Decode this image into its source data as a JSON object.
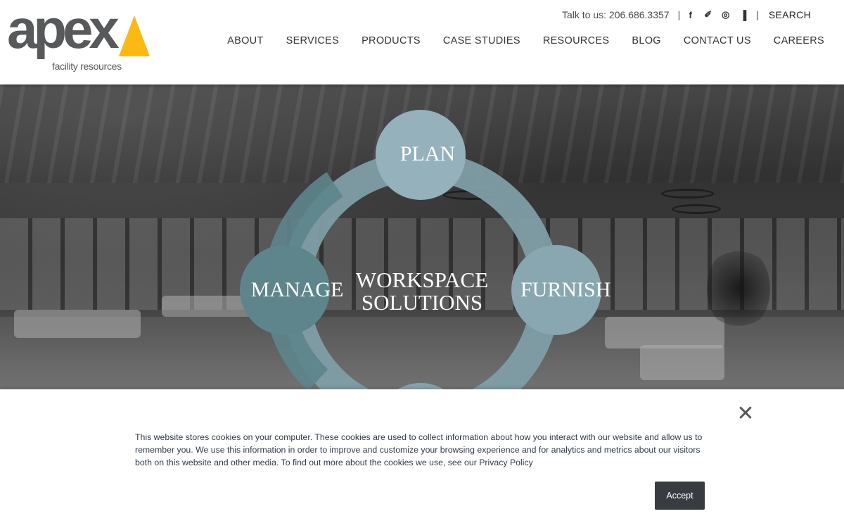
{
  "header": {
    "logo_text": "apex",
    "logo_subtext": "facility resources",
    "phone": "Talk to us: 206.686.3357",
    "separator": "|",
    "social_icons": [
      "facebook-icon",
      "twitter-icon",
      "instagram-icon",
      "houzz-icon"
    ],
    "social_glyphs": [
      "f",
      "✐",
      "◎",
      "▐"
    ],
    "search_label": "SEARCH",
    "nav": [
      "ABOUT",
      "SERVICES",
      "PRODUCTS",
      "CASE STUDIES",
      "RESOURCES",
      "BLOG",
      "CONTACT US",
      "CAREERS"
    ]
  },
  "hero": {
    "center_title_line1": "WORKSPACE",
    "center_title_line2": "SOLUTIONS",
    "cycle_labels": {
      "top": "PLAN",
      "right": "FURNISH",
      "left": "MANAGE"
    },
    "ring_color": "#7f9ea8",
    "ring_color_dark": "#5e858c"
  },
  "cookie_banner": {
    "text": "This website stores cookies on your computer. These cookies are used to collect information about how you interact with our website and allow us to remember you. We use this information in order to improve and customize your browsing experience and for analytics and metrics about our visitors both on this website and other media. To find out more about the cookies we use, see our Privacy Policy",
    "accept_label": "Accept",
    "close_glyph": "✕"
  },
  "colors": {
    "brand_gray": "#58595b",
    "brand_yellow": "#fdb913",
    "button_dark": "#383c40"
  }
}
